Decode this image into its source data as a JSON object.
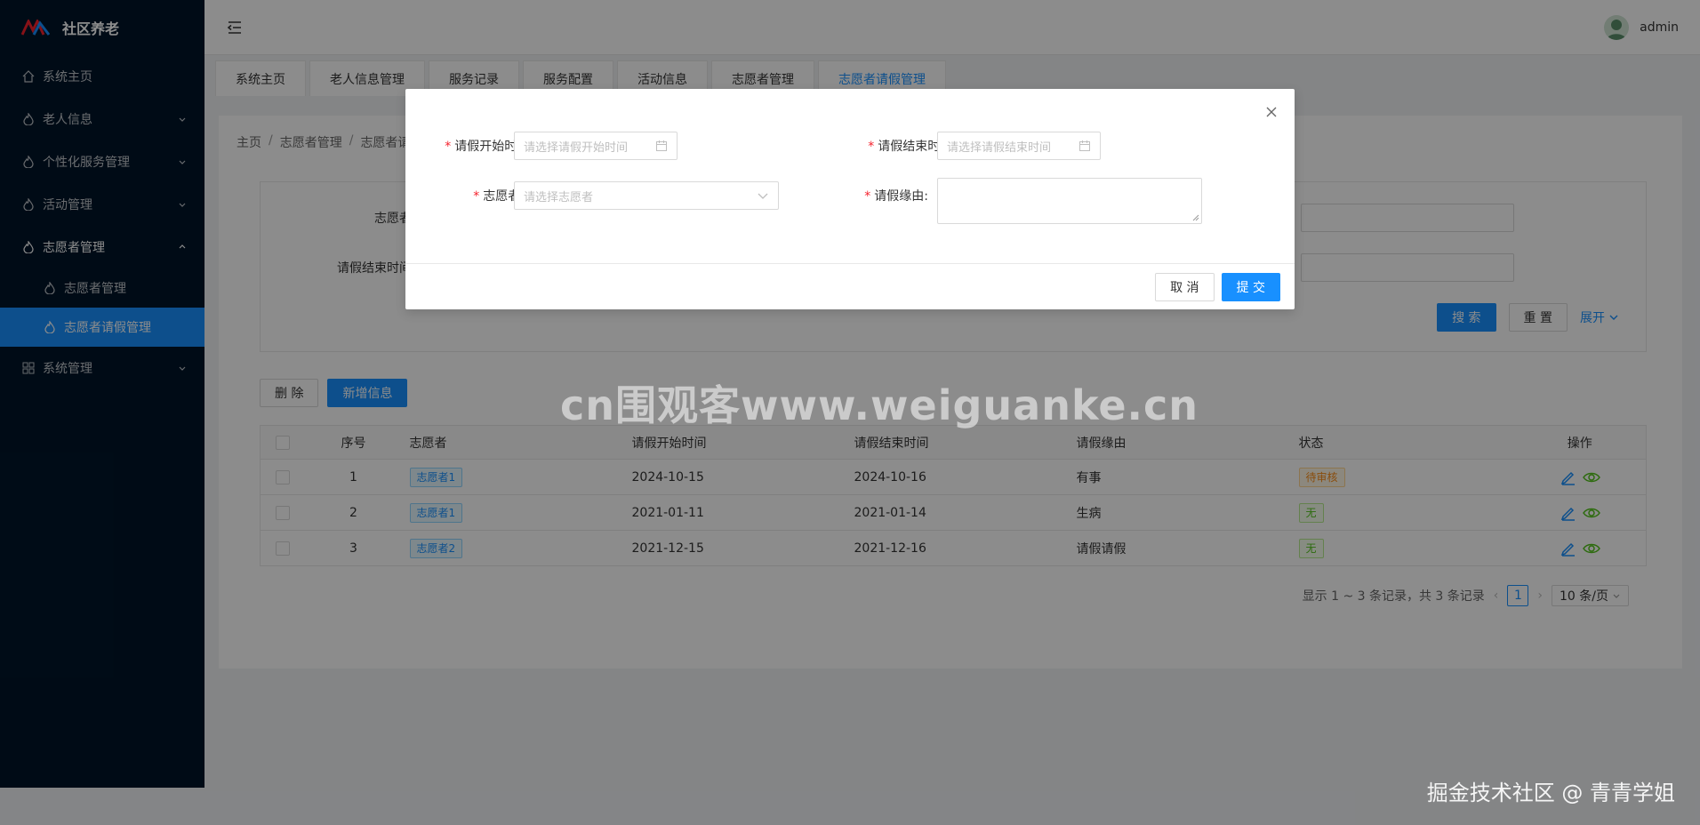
{
  "sidebar": {
    "brand": "社区养老",
    "items": [
      {
        "label": "系统主页",
        "icon": "home-icon"
      },
      {
        "label": "老人信息",
        "icon": "flame-icon"
      },
      {
        "label": "个性化服务管理",
        "icon": "flame-icon"
      },
      {
        "label": "活动管理",
        "icon": "flame-icon"
      },
      {
        "label": "志愿者管理",
        "icon": "flame-icon"
      },
      {
        "label": "志愿者管理",
        "icon": "flame-icon"
      },
      {
        "label": "志愿者请假管理",
        "icon": "flame-icon"
      },
      {
        "label": "系统管理",
        "icon": "grid-icon"
      }
    ]
  },
  "header": {
    "user": "admin"
  },
  "tabs": [
    "系统主页",
    "老人信息管理",
    "服务记录",
    "服务配置",
    "活动信息",
    "志愿者管理",
    "志愿者请假管理"
  ],
  "breadcrumb": [
    "主页",
    "志愿者管理",
    "志愿者请"
  ],
  "search": {
    "label_volunteer": "志愿者",
    "label_end": "请假结束时间",
    "search_btn": "搜 索",
    "reset_btn": "重 置",
    "expand_btn": "展开"
  },
  "toolbar": {
    "delete": "删 除",
    "add": "新增信息"
  },
  "table": {
    "headers": [
      "序号",
      "志愿者",
      "请假开始时间",
      "请假结束时间",
      "请假缘由",
      "状态",
      "操作"
    ],
    "rows": [
      {
        "idx": "1",
        "volunteer": "志愿者1",
        "start": "2024-10-15",
        "end": "2024-10-16",
        "reason": "有事",
        "status": "待审核"
      },
      {
        "idx": "2",
        "volunteer": "志愿者1",
        "start": "2021-01-11",
        "end": "2021-01-14",
        "reason": "生病",
        "status": "无"
      },
      {
        "idx": "3",
        "volunteer": "志愿者2",
        "start": "2021-12-15",
        "end": "2021-12-16",
        "reason": "请假请假",
        "status": "无"
      }
    ]
  },
  "pagination": {
    "summary": "显示 1 ~ 3 条记录，共 3 条记录",
    "current": "1",
    "page_size": "10 条/页"
  },
  "modal": {
    "start_label": "请假开始时间:",
    "start_placeholder": "请选择请假开始时间",
    "end_label": "请假结束时间:",
    "end_placeholder": "请选择请假结束时间",
    "volunteer_label": "志愿者:",
    "volunteer_placeholder": "请选择志愿者",
    "reason_label": "请假缘由:",
    "cancel": "取 消",
    "submit": "提 交"
  },
  "watermarks": {
    "center": "cn围观客www.weiguanke.cn",
    "corner": "掘金技术社区 @ 青青学姐"
  },
  "colors": {
    "primary": "#1890ff",
    "sidebar": "#001529",
    "required": "#f5222d"
  }
}
